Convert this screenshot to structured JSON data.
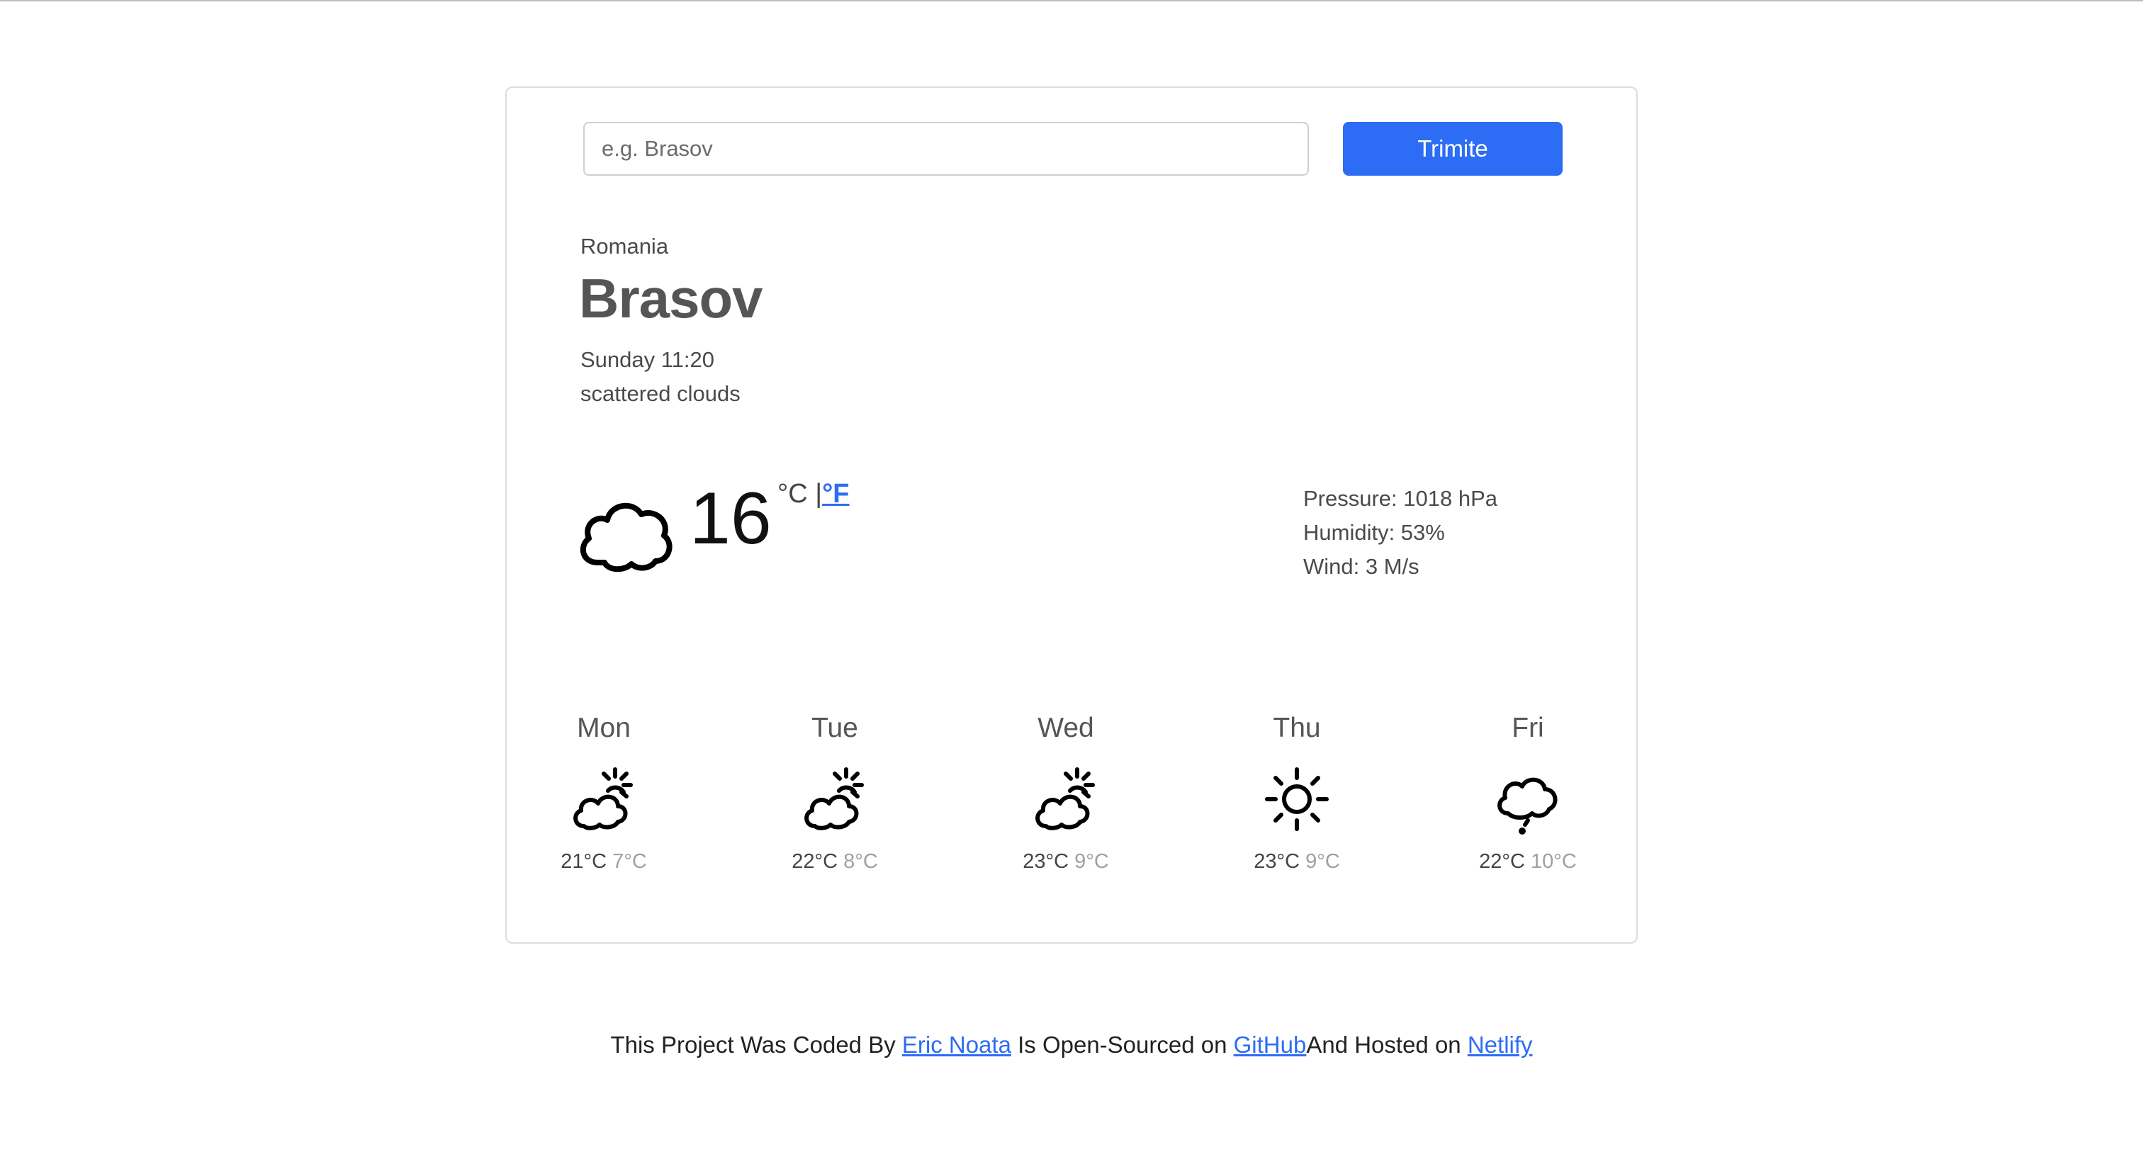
{
  "search": {
    "placeholder": "e.g. Brasov",
    "value": ""
  },
  "submit_label": "Trimite",
  "location": {
    "country": "Romania",
    "city": "Brasov"
  },
  "datetime": "Sunday 11:20",
  "description": "scattered clouds",
  "current": {
    "temperature": "16",
    "icon": "cloud-icon",
    "unit_celsius": "°C |",
    "unit_fahrenheit": "°F"
  },
  "details": {
    "pressure": "Pressure: 1018 hPa",
    "humidity": "Humidity: 53%",
    "wind": "Wind: 3 M/s"
  },
  "forecast": [
    {
      "day": "Mon",
      "icon": "partly-cloudy-icon",
      "high": "21°C",
      "low": "7°C"
    },
    {
      "day": "Tue",
      "icon": "partly-cloudy-icon",
      "high": "22°C",
      "low": "8°C"
    },
    {
      "day": "Wed",
      "icon": "partly-cloudy-icon",
      "high": "23°C",
      "low": "9°C"
    },
    {
      "day": "Thu",
      "icon": "sun-icon",
      "high": "23°C",
      "low": "9°C"
    },
    {
      "day": "Fri",
      "icon": "cloud-rain-icon",
      "high": "22°C",
      "low": "10°C"
    }
  ],
  "footer": {
    "prefix": "This Project Was Coded By ",
    "author_link": "Eric Noata",
    "middle": " Is Open-Sourced on ",
    "github_link": "GitHub",
    "and_text": "And Hosted on ",
    "netlify_link": "Netlify"
  }
}
